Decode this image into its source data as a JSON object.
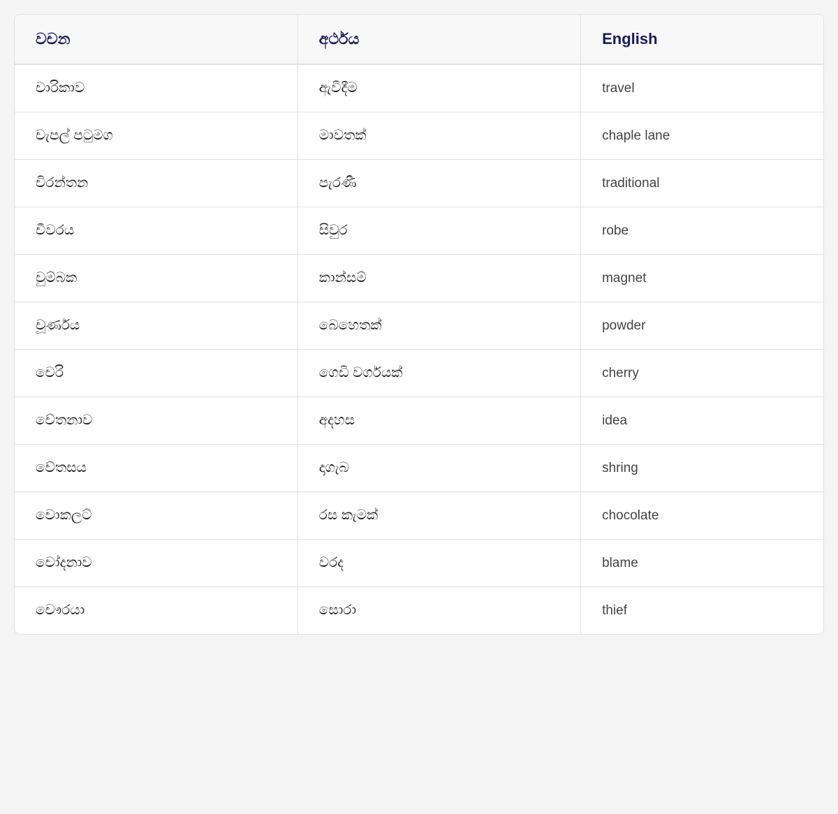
{
  "table": {
    "headers": [
      {
        "id": "col1",
        "label": "වචන"
      },
      {
        "id": "col2",
        "label": "අර්ථය"
      },
      {
        "id": "col3",
        "label": "English"
      }
    ],
    "rows": [
      {
        "col1": "චාරිකාව",
        "col2": "ඇවිදීම",
        "col3": "travel"
      },
      {
        "col1": "චැපල් පටුමග",
        "col2": "මාවතක්",
        "col3": "chaple lane"
      },
      {
        "col1": "චිරන්තන",
        "col2": "පැරණී",
        "col3": "traditional"
      },
      {
        "col1": "චීවරය",
        "col2": "සිවුර",
        "col3": "robe"
      },
      {
        "col1": "චුම්බක",
        "col2": "කාන්සම්",
        "col3": "magnet"
      },
      {
        "col1": "චූර්ණය",
        "col2": "බෙහෙතක්",
        "col3": "powder"
      },
      {
        "col1": "චෙරි",
        "col2": "ගෙඩි වර්ගයක්",
        "col3": "cherry"
      },
      {
        "col1": "චේතනාව",
        "col2": "අදහස",
        "col3": "idea"
      },
      {
        "col1": "චේතසය",
        "col2": "දාගැබ",
        "col3": "shring"
      },
      {
        "col1": "චොකලට්",
        "col2": "රස කැමක්",
        "col3": "chocolate"
      },
      {
        "col1": "චෝදනාව",
        "col2": "වරද",
        "col3": "blame"
      },
      {
        "col1": "චෞරයා",
        "col2": "සොරා",
        "col3": "thief"
      }
    ]
  }
}
